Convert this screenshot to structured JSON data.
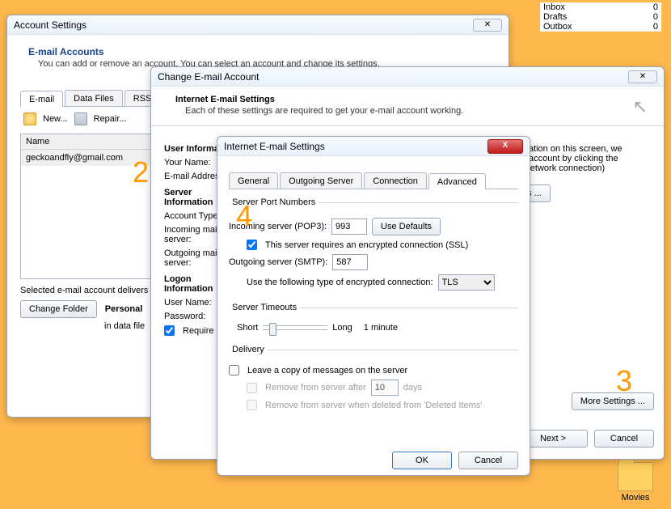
{
  "mail_counts": [
    {
      "label": "Inbox",
      "count": "0"
    },
    {
      "label": "Drafts",
      "count": "0"
    },
    {
      "label": "Outbox",
      "count": "0"
    }
  ],
  "desktop": {
    "folder_label": "Movies"
  },
  "account_settings": {
    "title": "Account Settings",
    "heading": "E-mail Accounts",
    "subtext": "You can add or remove an account. You can select an account and change its settings.",
    "tabs": [
      "E-mail",
      "Data Files",
      "RSS Feeds"
    ],
    "toolbar": {
      "new": "New...",
      "repair": "Repair..."
    },
    "list_header": "Name",
    "list_rows": [
      "geckoandfly@gmail.com"
    ],
    "selected_text": "Selected e-mail account delivers",
    "folder_desc": "in data file",
    "personal_label": "Personal",
    "change_folder_btn": "Change Folder"
  },
  "change_account": {
    "title": "Change E-mail Account",
    "heading": "Internet E-mail Settings",
    "subtext": "Each of these settings are required to get your e-mail account working.",
    "user_info": "User Information",
    "your_name": "Your Name:",
    "email_addr": "E-mail Address:",
    "server_info": "Server Information",
    "account_t": "Account Type:",
    "incoming_m": "Incoming mail server:",
    "outgoing_m": "Outgoing mail server:",
    "logon_info": "Logon Information",
    "user_name": "User Name:",
    "password": "Password:",
    "require_cb": "Require",
    "info_text1": "ormation on this screen, we",
    "info_text2": "our account by clicking the",
    "info_text3": "es network connection)",
    "gs_btn": "gs ...",
    "more_btn": "More Settings ...",
    "next_btn": "Next >",
    "cancel_btn": "Cancel"
  },
  "inet": {
    "title": "Internet E-mail Settings",
    "tabs": [
      "General",
      "Outgoing Server",
      "Connection",
      "Advanced"
    ],
    "fieldset1": "Server Port Numbers",
    "incoming_label": "Incoming server (POP3):",
    "incoming_value": "993",
    "use_defaults": "Use Defaults",
    "ssl_cb": "This server requires an encrypted connection (SSL)",
    "outgoing_label": "Outgoing server (SMTP):",
    "outgoing_value": "587",
    "enc_label": "Use the following type of encrypted connection:",
    "enc_value": "TLS",
    "fieldset2": "Server Timeouts",
    "short": "Short",
    "long": "Long",
    "timeout": "1 minute",
    "fieldset3": "Delivery",
    "leave_copy": "Leave a copy of messages on the server",
    "remove_after": "Remove from server after",
    "remove_days_value": "10",
    "days": "days",
    "remove_deleted": "Remove from server when deleted from 'Deleted Items'",
    "ok": "OK",
    "cancel": "Cancel"
  },
  "overlays": {
    "n2": "2",
    "n3": "3",
    "n4": "4"
  }
}
